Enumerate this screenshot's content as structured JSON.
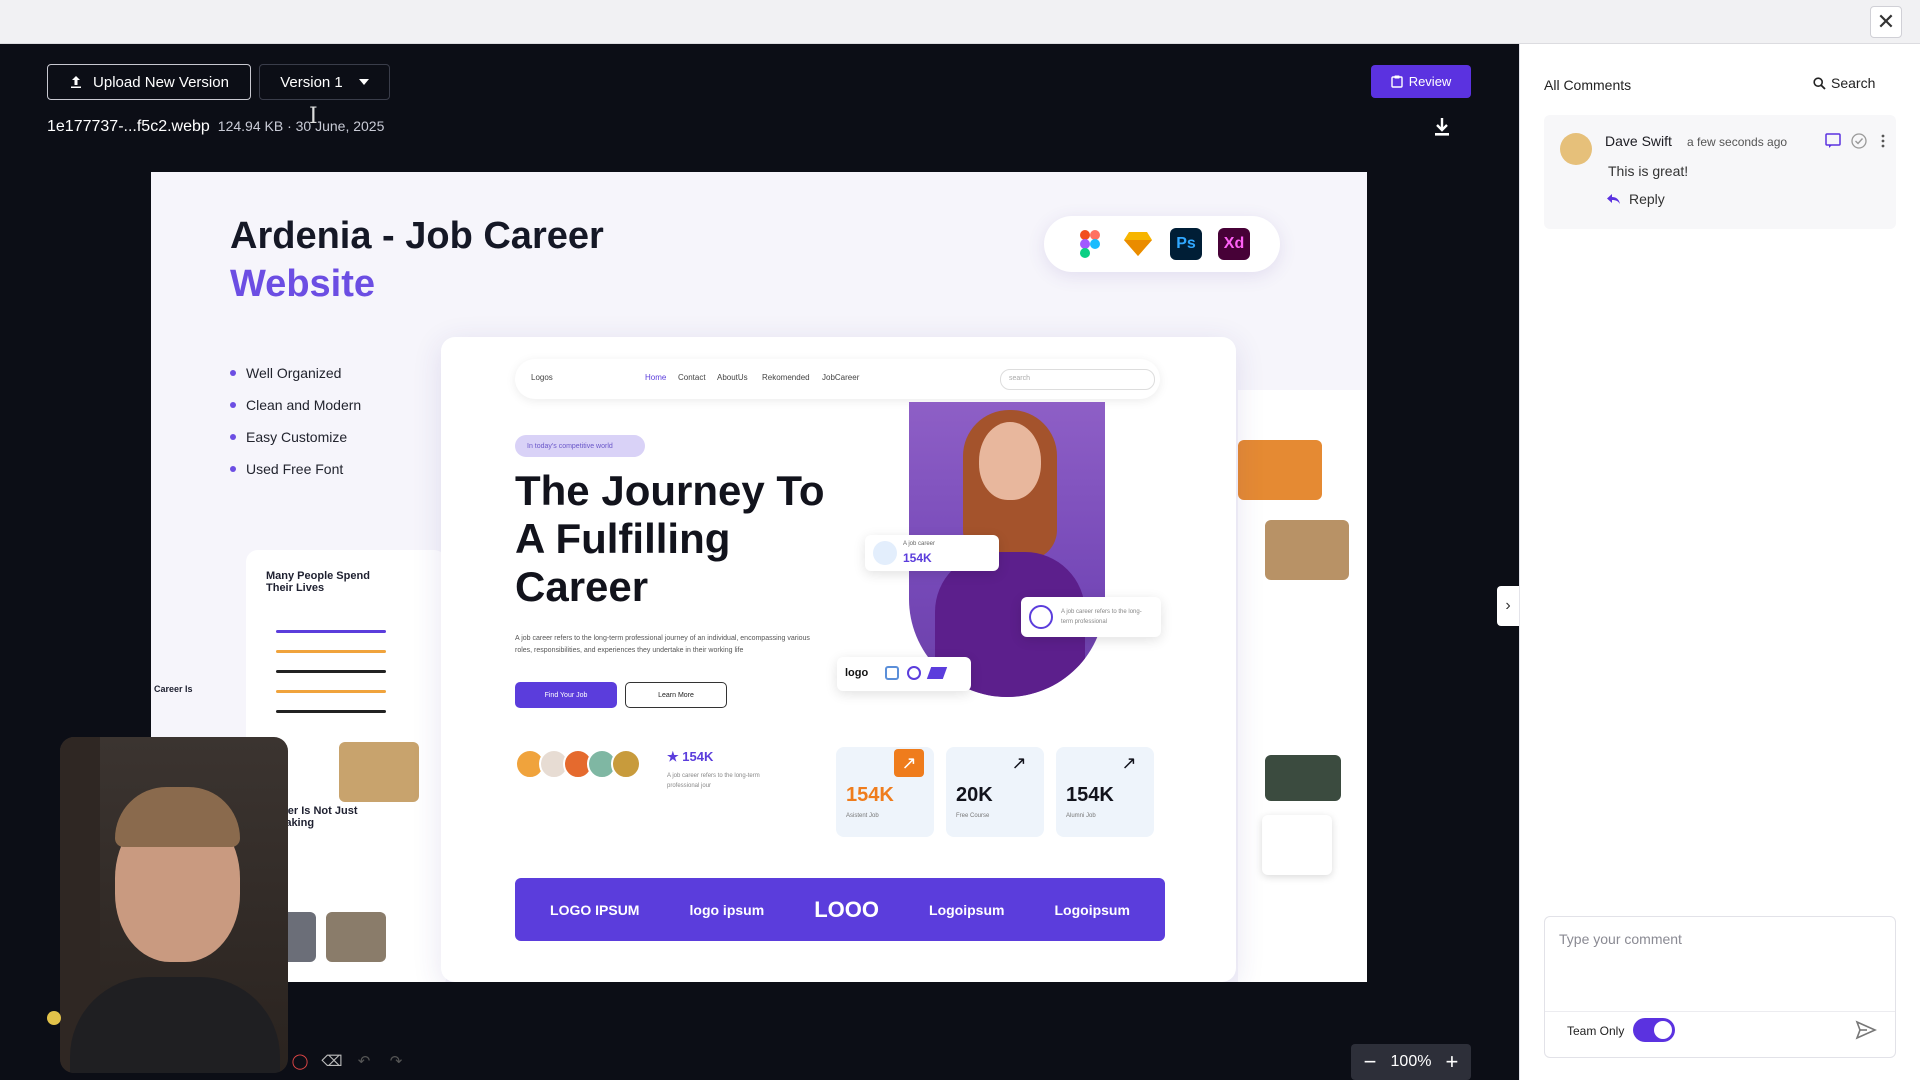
{
  "header": {
    "close_label": "✕"
  },
  "toolbar": {
    "upload_label": "Upload New Version",
    "version_label": "Version 1",
    "review_label": "Review"
  },
  "file": {
    "name": "1e177737-...f5c2.webp",
    "info": "124.94 KB · 30 June, 2025"
  },
  "canvas": {
    "title_line1": "Ardenia - Job Career",
    "title_line2": "Website",
    "features": [
      "Well Organized",
      "Clean and Modern",
      "Easy Customize",
      "Used Free Font"
    ],
    "tools": [
      {
        "label": "",
        "icon": "figma-icon",
        "color": "#f24e1e"
      },
      {
        "label": "",
        "icon": "sketch-icon",
        "color": "#f7b500"
      },
      {
        "label": "Ps",
        "icon": "photoshop-icon",
        "color": "#31a8ff"
      },
      {
        "label": "Xd",
        "icon": "xd-icon",
        "color": "#ff61f6"
      }
    ],
    "left_card_title": "Many People Spend Their Lives",
    "left_card_title2": "r Career Is Not Just out Making",
    "career_label": "Career Is",
    "nav": {
      "logo": "Logos",
      "home": "Home",
      "contact": "Contact",
      "about": "AboutUs",
      "recommended": "Rekomended",
      "jobcareer": "JobCareer",
      "search_placeholder": "search"
    },
    "pill": "In today's competitive world",
    "hero_title": "The Journey To A Fulfilling Career",
    "hero_desc": "A job career refers to the long-term professional journey of an individual, encompassing various roles, responsibilities, and experiences they undertake in their working life",
    "hero_btn1": "Find Your Job",
    "hero_btn2": "Learn More",
    "badge_small": "A job career",
    "badge_value": "154K",
    "badge2_text": "A job career refers to the long-term professional",
    "rating_value": "★ 154K",
    "rating_desc": "A job career refers to the long-term professional jour",
    "kpis": [
      {
        "value": "154K",
        "label": "Asistent Job"
      },
      {
        "value": "20K",
        "label": "Free Course"
      },
      {
        "value": "154K",
        "label": "Alumni Job"
      }
    ],
    "logos": [
      "LOGO IPSUM",
      "logo ipsum",
      "LOOO",
      "Logoipsum",
      "Logoipsum"
    ]
  },
  "zoom": {
    "value": "100%",
    "minus": "−",
    "plus": "+"
  },
  "comments": {
    "heading": "All Comments",
    "search_label": "Search",
    "items": [
      {
        "author": "Dave Swift",
        "time": "a few seconds ago",
        "text": "This is great!",
        "reply_label": "Reply"
      }
    ],
    "composer": {
      "placeholder": "Type your comment",
      "team_only_label": "Team Only",
      "team_only": true
    }
  },
  "colors": {
    "accent": "#5b32e0",
    "brand_purple": "#6c4ee3",
    "status_dot": "#e2c24a"
  }
}
